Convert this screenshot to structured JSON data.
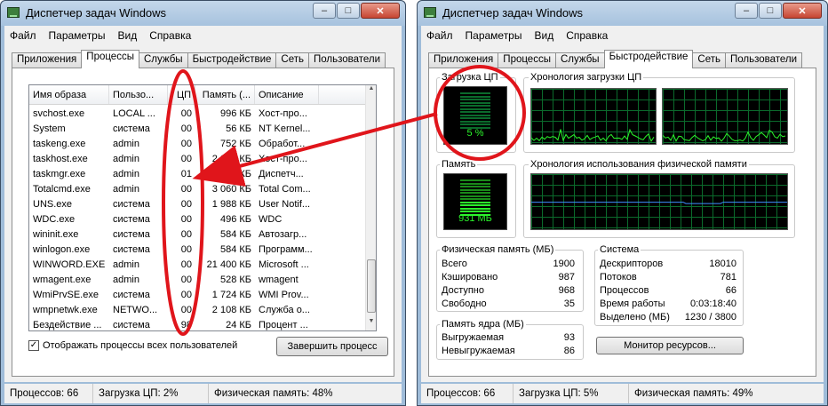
{
  "left": {
    "title": "Диспетчер задач Windows",
    "title_buttons": [
      "–",
      "□",
      "✕"
    ],
    "menu": [
      "Файл",
      "Параметры",
      "Вид",
      "Справка"
    ],
    "tabs": [
      "Приложения",
      "Процессы",
      "Службы",
      "Быстродействие",
      "Сеть",
      "Пользователи"
    ],
    "active_tab": "Процессы",
    "columns": [
      "Имя образа",
      "Пользо...",
      "ЦП",
      "Память (...",
      "Описание"
    ],
    "rows": [
      [
        "svchost.exe",
        "LOCAL ...",
        "00",
        "996 КБ",
        "Хост-про..."
      ],
      [
        "System",
        "система",
        "00",
        "56 КБ",
        "NT Kernel..."
      ],
      [
        "taskeng.exe",
        "admin",
        "00",
        "752 КБ",
        "Обработ..."
      ],
      [
        "taskhost.exe",
        "admin",
        "00",
        "2 060 КБ",
        "Хост-про..."
      ],
      [
        "taskmgr.exe",
        "admin",
        "01",
        "2 084 КБ",
        "Диспетч..."
      ],
      [
        "Totalcmd.exe",
        "admin",
        "00",
        "3 060 КБ",
        "Total Com..."
      ],
      [
        "UNS.exe",
        "система",
        "00",
        "1 988 КБ",
        "User Notif..."
      ],
      [
        "WDC.exe",
        "система",
        "00",
        "496 КБ",
        "WDC"
      ],
      [
        "wininit.exe",
        "система",
        "00",
        "584 КБ",
        "Автозагр..."
      ],
      [
        "winlogon.exe",
        "система",
        "00",
        "584 КБ",
        "Программ..."
      ],
      [
        "WINWORD.EXE",
        "admin",
        "00",
        "21 400 КБ",
        "Microsoft ..."
      ],
      [
        "wmagent.exe",
        "admin",
        "00",
        "528 КБ",
        "wmagent"
      ],
      [
        "WmiPrvSE.exe",
        "система",
        "00",
        "1 724 КБ",
        "WMI Prov..."
      ],
      [
        "wmpnetwk.exe",
        "NETWO...",
        "00",
        "2 108 КБ",
        "Служба о..."
      ],
      [
        "Бездействие ...",
        "система",
        "98",
        "24 КБ",
        "Процент ..."
      ]
    ],
    "show_all_label": "Отображать процессы всех пользователей",
    "end_process_label": "Завершить процесс",
    "status": [
      "Процессов: 66",
      "Загрузка ЦП: 2%",
      "Физическая память: 48%"
    ]
  },
  "right": {
    "title": "Диспетчер задач Windows",
    "title_buttons": [
      "–",
      "□",
      "✕"
    ],
    "menu": [
      "Файл",
      "Параметры",
      "Вид",
      "Справка"
    ],
    "tabs": [
      "Приложения",
      "Процессы",
      "Службы",
      "Быстродействие",
      "Сеть",
      "Пользователи"
    ],
    "active_tab": "Быстродействие",
    "cpu_label": "Загрузка ЦП",
    "cpu_value": "5 %",
    "cpu_history_label": "Хронология загрузки ЦП",
    "mem_label": "Память",
    "mem_value": "931 МБ",
    "mem_history_label": "Хронология использования физической памяти",
    "phys_title": "Физическая память (МБ)",
    "phys": [
      [
        "Всего",
        "1900"
      ],
      [
        "Кэшировано",
        "987"
      ],
      [
        "Доступно",
        "968"
      ],
      [
        "Свободно",
        "35"
      ]
    ],
    "kernel_title": "Память ядра (МБ)",
    "kernel": [
      [
        "Выгружаемая",
        "93"
      ],
      [
        "Невыгружаемая",
        "86"
      ]
    ],
    "system_title": "Система",
    "system": [
      [
        "Дескрипторов",
        "18010"
      ],
      [
        "Потоков",
        "781"
      ],
      [
        "Процессов",
        "66"
      ],
      [
        "Время работы",
        "0:03:18:40"
      ],
      [
        "Выделено (МБ)",
        "1230 / 3800"
      ]
    ],
    "resource_monitor_label": "Монитор ресурсов...",
    "status": [
      "Процессов: 66",
      "Загрузка ЦП: 5%",
      "Физическая память: 49%"
    ]
  },
  "colors": {
    "annotation": "#e0151b",
    "graph_line": "#2bf52b",
    "mem_line": "#3e8fff"
  }
}
